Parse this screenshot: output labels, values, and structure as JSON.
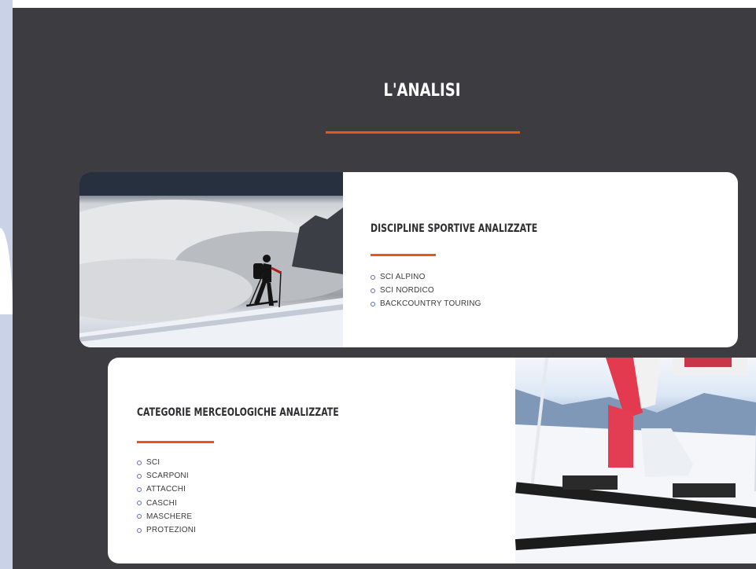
{
  "section": {
    "title": "L'ANALISI"
  },
  "cards": [
    {
      "heading": "DISCIPLINE SPORTIVE ANALIZZATE",
      "items": [
        "SCI ALPINO",
        "SCI NORDICO",
        "BACKCOUNTRY TOURING"
      ]
    },
    {
      "heading": "CATEGORIE MERCEOLOGICHE ANALIZZATE",
      "items": [
        "SCI",
        "SCARPONI",
        "ATTACCHI",
        "CASCHI",
        "MASCHERE",
        "PROTEZIONI"
      ]
    }
  ],
  "images": {
    "card1": "ski-touring-photo",
    "card2": "ski-boot-photo"
  },
  "colors": {
    "background": "#3d3c41",
    "accent": "#e8561d",
    "bullet": "#5f6bb4",
    "card": "#ffffff",
    "left_strip": "#c9d2e6"
  }
}
